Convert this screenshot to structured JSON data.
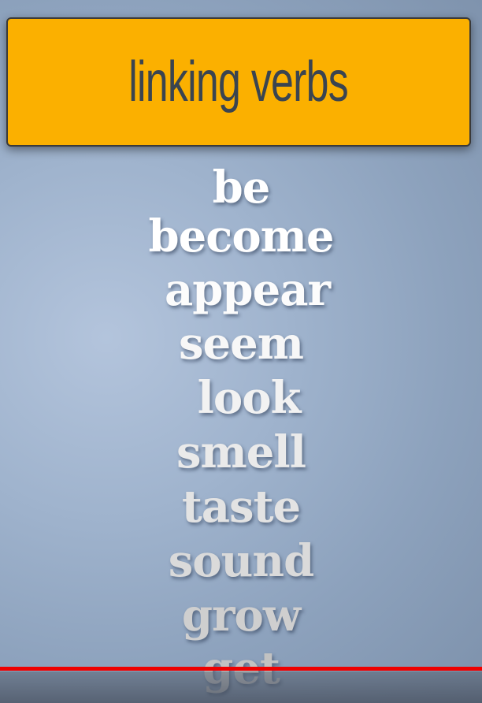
{
  "title": "linking verbs",
  "words": [
    "be",
    "become",
    "appear",
    "seem",
    "look",
    "smell",
    "taste",
    "sound",
    "grow",
    "get"
  ],
  "colors": {
    "banner": "#fbb000",
    "title_text": "#3a4450",
    "progress": "#ee0000"
  },
  "video": {
    "progress": 1.0
  }
}
